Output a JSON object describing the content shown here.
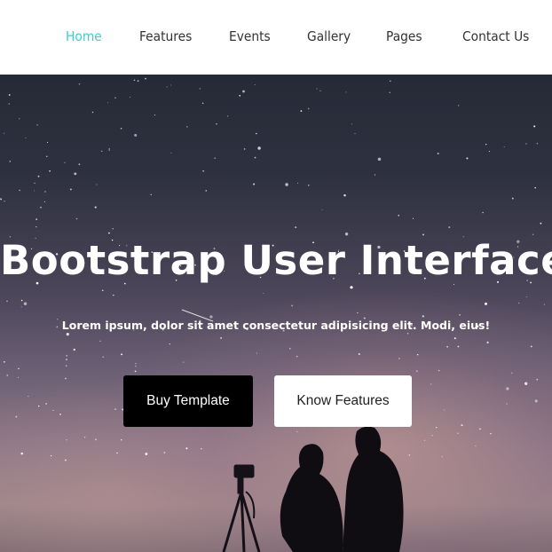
{
  "nav": {
    "items": [
      {
        "label": "Home",
        "active": true
      },
      {
        "label": "Features",
        "active": false
      },
      {
        "label": "Events",
        "active": false
      },
      {
        "label": "Gallery",
        "active": false
      },
      {
        "label": "Pages",
        "active": false
      },
      {
        "label": "Contact Us",
        "active": false
      }
    ],
    "active_color": "#3ecfcf",
    "text_color": "#333333"
  },
  "hero": {
    "title": "Bootstrap User Interface",
    "subtitle": "Lorem ipsum, dolor sit amet consectetur adipisicing elit. Modi, eius!",
    "buttons": {
      "buy_label": "Buy Template",
      "know_label": "Know Features"
    }
  }
}
